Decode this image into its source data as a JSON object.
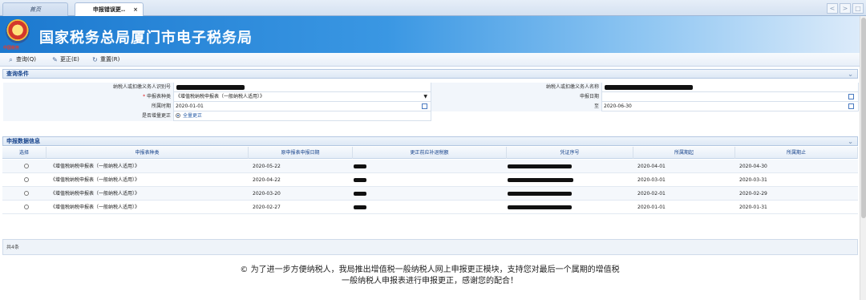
{
  "tabs": {
    "home": "首页",
    "active": "申报错误更..",
    "close": "×"
  },
  "nav": {
    "prev": "<",
    "next": ">",
    "max": "□"
  },
  "header": {
    "title": "国家税务总局厦门市电子税务局",
    "logo_text": "中国税务"
  },
  "toolbar": {
    "query": "查询(Q)",
    "correct": "更正(E)",
    "reset": "重置(R)"
  },
  "query_panel": {
    "title": "查询条件",
    "taxpayer_id_label": "纳税人或扣缴义务人识别号",
    "taxpayer_name_label": "纳税人或扣缴义务人名称",
    "report_type_label": "申报表种类",
    "report_type_value": "《增值税纳税申报表（一般纳税人适用）》",
    "report_date_label": "申报日期",
    "period_label": "所属时期",
    "period_from": "2020-01-01",
    "period_to_label": "至",
    "period_to": "2020-06-30",
    "incremental_label": "是否增量更正",
    "incremental_value": "全量更正"
  },
  "data_panel": {
    "title": "申报数据信息",
    "columns": [
      "选择",
      "申报表种类",
      "原申报表申报日期",
      "更正前应补退税额",
      "凭证序号",
      "所属期起",
      "所属期止"
    ],
    "rows": [
      {
        "type": "《增值税纳税申报表（一般纳税人适用）》",
        "date": "2020-05-22",
        "start": "2020-04-01",
        "end": "2020-04-30"
      },
      {
        "type": "《增值税纳税申报表（一般纳税人适用）》",
        "date": "2020-04-22",
        "start": "2020-03-01",
        "end": "2020-03-31"
      },
      {
        "type": "《增值税纳税申报表（一般纳税人适用）》",
        "date": "2020-03-20",
        "start": "2020-02-01",
        "end": "2020-02-29"
      },
      {
        "type": "《增值税纳税申报表（一般纳税人适用）》",
        "date": "2020-02-27",
        "start": "2020-01-01",
        "end": "2020-01-31"
      }
    ],
    "footer": "共4条"
  },
  "notice": {
    "line1": "© 为了进一步方便纳税人，我局推出增值税一般纳税人网上申报更正模块，支持您对最后一个属期的增值税",
    "line2": "一般纳税人申报表进行申报更正，感谢您的配合！"
  }
}
